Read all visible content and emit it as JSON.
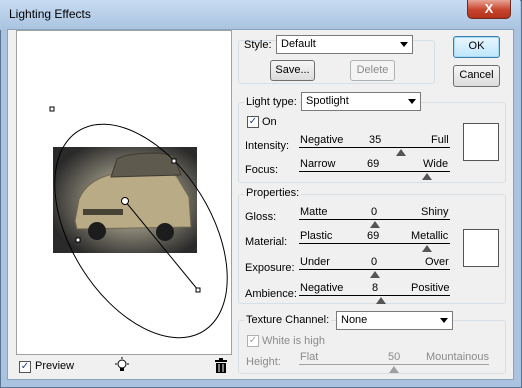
{
  "window": {
    "title": "Lighting Effects",
    "close": "X"
  },
  "buttons": {
    "ok": "OK",
    "cancel": "Cancel"
  },
  "style": {
    "label": "Style:",
    "value": "Default",
    "save": "Save...",
    "delete": "Delete"
  },
  "light": {
    "type_label": "Light type:",
    "type_value": "Spotlight",
    "on_label": "On",
    "on_checked": true,
    "intensity": {
      "label": "Intensity:",
      "left": "Negative",
      "right": "Full",
      "value": "35",
      "position": 0.675
    },
    "focus": {
      "label": "Focus:",
      "left": "Narrow",
      "right": "Wide",
      "value": "69",
      "position": 0.845
    }
  },
  "properties": {
    "label": "Properties:",
    "gloss": {
      "label": "Gloss:",
      "left": "Matte",
      "right": "Shiny",
      "value": "0",
      "position": 0.5
    },
    "material": {
      "label": "Material:",
      "left": "Plastic",
      "right": "Metallic",
      "value": "69",
      "position": 0.845
    },
    "exposure": {
      "label": "Exposure:",
      "left": "Under",
      "right": "Over",
      "value": "0",
      "position": 0.5
    },
    "ambience": {
      "label": "Ambience:",
      "left": "Negative",
      "right": "Positive",
      "value": "8",
      "position": 0.54
    }
  },
  "texture": {
    "label": "Texture Channel:",
    "value": "None",
    "white_is_high": "White is high",
    "height": {
      "label": "Height:",
      "left": "Flat",
      "right": "Mountainous",
      "value": "50",
      "position": 0.5
    }
  },
  "preview": {
    "label": "Preview",
    "checked": true
  },
  "colors": {
    "accent": "#3c7fb1",
    "titlebar": "#a9c3e0",
    "close": "#c7432c"
  }
}
